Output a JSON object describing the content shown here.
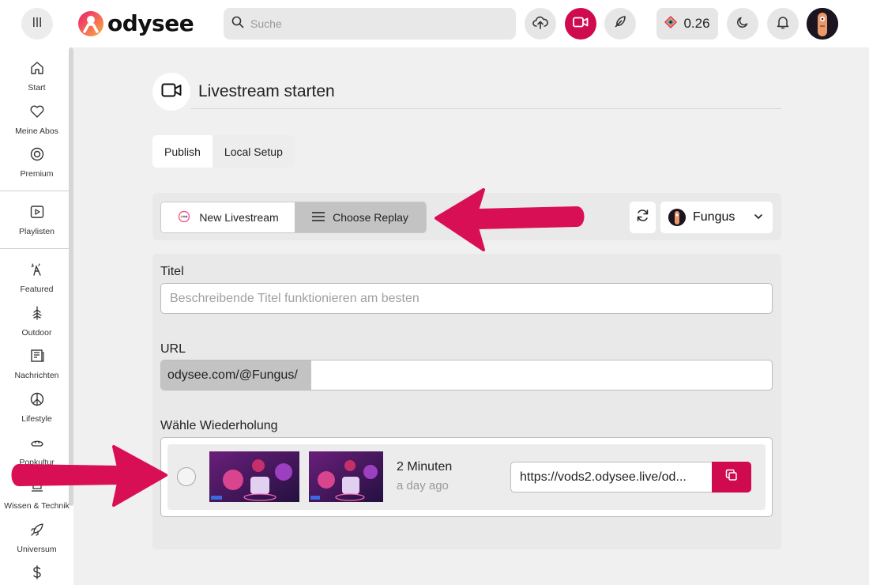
{
  "header": {
    "logo_text": "odysee",
    "search": {
      "placeholder": "Suche"
    },
    "credits": "0.26",
    "colors": {
      "accent": "#cf0a4f"
    }
  },
  "sidebar": {
    "items": [
      {
        "label": "Start",
        "icon": "home-icon"
      },
      {
        "label": "Meine Abos",
        "icon": "heart-icon"
      },
      {
        "label": "Premium",
        "icon": "premium-icon"
      },
      {
        "label": "Playlisten",
        "icon": "playlist-icon"
      },
      {
        "label": "Featured",
        "icon": "featured-icon"
      },
      {
        "label": "Outdoor",
        "icon": "tree-icon"
      },
      {
        "label": "Nachrichten",
        "icon": "news-icon"
      },
      {
        "label": "Lifestyle",
        "icon": "peace-icon"
      },
      {
        "label": "Popkultur",
        "icon": "popculture-icon"
      },
      {
        "label": "Wissen & Technik",
        "icon": "science-icon"
      },
      {
        "label": "Universum",
        "icon": "rocket-icon"
      },
      {
        "label": "",
        "icon": "dollar-icon"
      }
    ]
  },
  "main": {
    "title": "Livestream starten",
    "tabs": [
      {
        "label": "Publish",
        "active": true
      },
      {
        "label": "Local Setup",
        "active": false
      }
    ],
    "mode": {
      "new_livestream": "New Livestream",
      "choose_replay": "Choose Replay",
      "selected": "Choose Replay"
    },
    "channel": "Fungus",
    "form": {
      "title_label": "Titel",
      "title_placeholder": "Beschreibende Titel funktionieren am besten",
      "url_label": "URL",
      "url_prefix": "odysee.com/@Fungus/",
      "url_value": "",
      "replay_label": "Wähle Wiederholung",
      "replays": [
        {
          "duration": "2 Minuten",
          "age": "a day ago",
          "url": "https://vods2.odysee.live/od..."
        }
      ]
    }
  }
}
